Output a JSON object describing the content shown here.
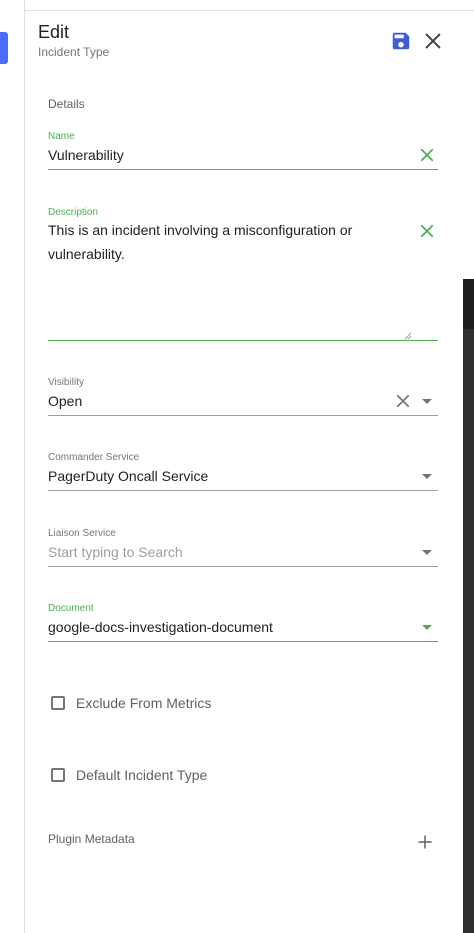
{
  "header": {
    "title": "Edit",
    "subtitle": "Incident Type"
  },
  "details": {
    "section_label": "Details",
    "name": {
      "label": "Name",
      "value": "Vulnerability"
    },
    "description": {
      "label": "Description",
      "value": "This is an incident involving a misconfiguration or vulnerability."
    },
    "visibility": {
      "label": "Visibility",
      "value": "Open"
    },
    "commander_service": {
      "label": "Commander Service",
      "value": "PagerDuty Oncall Service"
    },
    "liaison_service": {
      "label": "Liaison Service",
      "placeholder": "Start typing to Search"
    },
    "document": {
      "label": "Document",
      "value": "google-docs-investigation-document"
    },
    "exclude_from_metrics": {
      "label": "Exclude From Metrics",
      "checked": false
    },
    "default_incident_type": {
      "label": "Default Incident Type",
      "checked": false
    }
  },
  "plugin_metadata": {
    "label": "Plugin Metadata"
  },
  "colors": {
    "accent_green": "#4caf50",
    "save_blue": "#3f5bd9",
    "left_button_blue": "#4a6cf7"
  },
  "icons": {
    "save": "floppy-disk-icon",
    "close": "close-icon",
    "clear": "clear-x-icon",
    "dropdown": "caret-down-icon",
    "add": "plus-icon"
  }
}
